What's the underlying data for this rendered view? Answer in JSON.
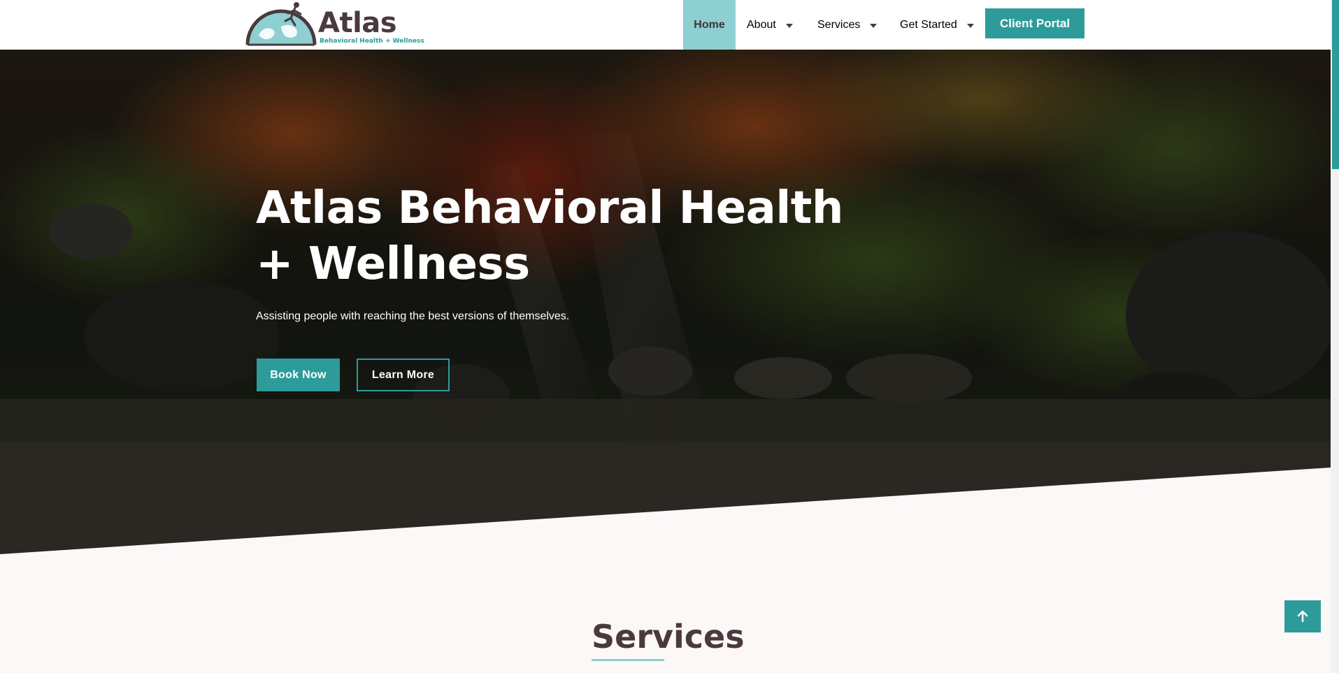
{
  "header": {
    "logo": {
      "word": "Atlas",
      "tagline": "Behavioral Health + Wellness"
    },
    "nav": [
      {
        "label": "Home",
        "active": true
      },
      {
        "label": "About",
        "dropdown": true
      },
      {
        "label": "Services",
        "dropdown": true
      },
      {
        "label": "Get Started",
        "dropdown": true
      }
    ],
    "portal_label": "Client Portal"
  },
  "hero": {
    "title": "Atlas Behavioral Health + Wellness",
    "subtitle": "Assisting people with reaching the best versions of themselves.",
    "book_label": "Book Now",
    "learn_label": "Learn More"
  },
  "services": {
    "title": "Services"
  },
  "scroll_top": {
    "icon": "arrow-up-icon"
  },
  "colors": {
    "accent": "#2e9b9b",
    "accent_light": "#8ecfd2",
    "text_dark": "#4a3a3d",
    "page_bg": "#fcf8f7"
  }
}
